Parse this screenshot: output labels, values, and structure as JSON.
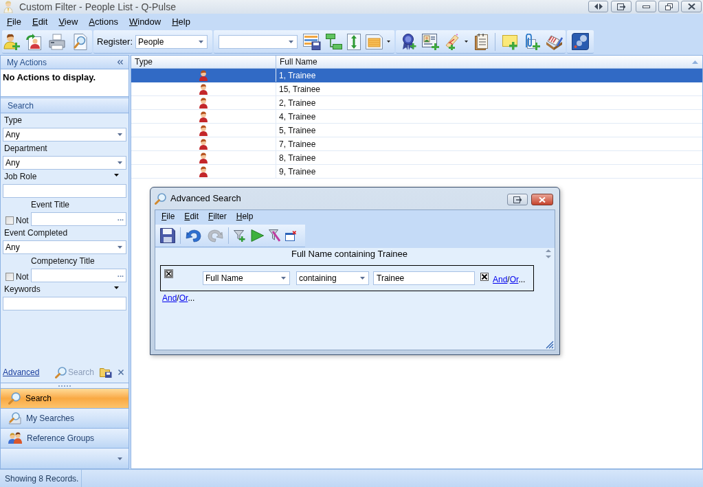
{
  "window": {
    "title": "Custom Filter - People List - Q-Pulse"
  },
  "menu": [
    "File",
    "Edit",
    "View",
    "Actions",
    "Window",
    "Help"
  ],
  "toolbar": {
    "register_label": "Register:",
    "register_value": "People"
  },
  "sidebar": {
    "my_actions": {
      "title": "My Actions",
      "message": "No Actions to display."
    },
    "search": {
      "title": "Search",
      "fields": [
        {
          "kind": "combo",
          "label": "Type",
          "value": "Any"
        },
        {
          "kind": "combo",
          "label": "Department",
          "value": "Any"
        },
        {
          "kind": "text",
          "label": "Job Role"
        },
        {
          "kind": "lookup",
          "label": "Event Title",
          "not_label": "Not",
          "not_checked": false,
          "browse": "..."
        },
        {
          "kind": "combo",
          "label": "Event Completed",
          "value": "Any"
        },
        {
          "kind": "lookup",
          "label": "Competency Title",
          "not_label": "Not",
          "not_checked": false,
          "browse": "..."
        },
        {
          "kind": "text",
          "label": "Keywords"
        }
      ],
      "advanced_link": "Advanced",
      "search_button": {
        "label": "Search",
        "disabled": true
      }
    },
    "nav": [
      {
        "label": "Search",
        "selected": true
      },
      {
        "label": "My Searches",
        "selected": false
      },
      {
        "label": "Reference Groups",
        "selected": false
      }
    ]
  },
  "table": {
    "columns": [
      {
        "label": "Type",
        "sorted": false
      },
      {
        "label": "Full Name",
        "sorted": true
      }
    ],
    "rows": [
      {
        "full_name": "1, Trainee",
        "selected": true
      },
      {
        "full_name": "15, Trainee",
        "selected": false
      },
      {
        "full_name": "2, Trainee",
        "selected": false
      },
      {
        "full_name": "4, Trainee",
        "selected": false
      },
      {
        "full_name": "5, Trainee",
        "selected": false
      },
      {
        "full_name": "7, Trainee",
        "selected": false
      },
      {
        "full_name": "8, Trainee",
        "selected": false
      },
      {
        "full_name": "9, Trainee",
        "selected": false
      }
    ]
  },
  "dialog": {
    "title": "Advanced Search",
    "menu": [
      "File",
      "Edit",
      "Filter",
      "Help"
    ],
    "summary": "Full Name containing Trainee",
    "criteria": [
      {
        "field": "Full Name",
        "operator": "containing",
        "value": "Trainee",
        "and_or": [
          {
            "kind": "link",
            "text": "And"
          },
          {
            "kind": "plain",
            "text": "/"
          },
          {
            "kind": "link",
            "text": "Or"
          },
          {
            "kind": "plain",
            "text": "..."
          }
        ]
      }
    ],
    "and_or": [
      {
        "kind": "link",
        "text": "And"
      },
      {
        "kind": "plain",
        "text": "/"
      },
      {
        "kind": "link",
        "text": "Or"
      },
      {
        "kind": "plain",
        "text": "..."
      }
    ]
  },
  "status_bar": {
    "text": "Showing 8 Records."
  }
}
